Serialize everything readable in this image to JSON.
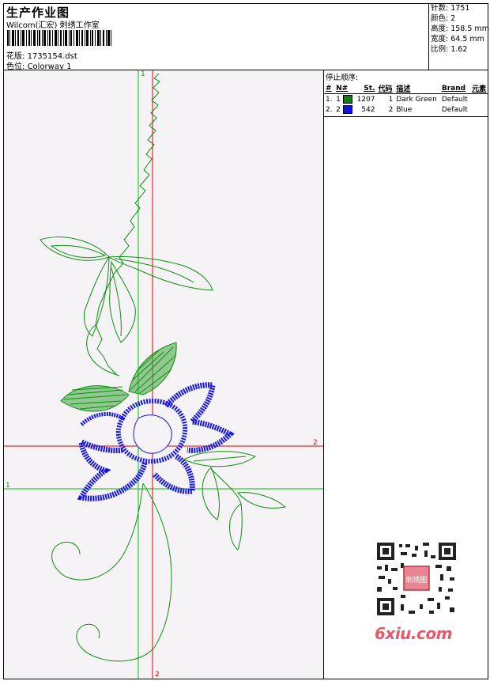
{
  "header": {
    "title": "生产作业图",
    "company": "Wilcom(汇宏) 刺绣工作室",
    "design_label": "花版:",
    "design_file": "1735154.dst",
    "colorway_label": "色位:",
    "colorway_value": "Colorway 1"
  },
  "stats": {
    "stitches": "针数: 1751",
    "colors": "颜色: 2",
    "height": "高度: 158.5 mm",
    "width": "宽度: 64.5 mm",
    "scale": "比例: 1.62"
  },
  "stop_sequence": {
    "title": "停止顺序:",
    "columns": [
      "#",
      "N#",
      "St.",
      "代码",
      "描述",
      "Brand",
      "元素"
    ],
    "rows": [
      {
        "num": "1.",
        "n": "1",
        "color": "#0f7f0f",
        "st": "1207",
        "code": "1",
        "desc": "Dark Green",
        "brand": "Default",
        "element": ""
      },
      {
        "num": "2.",
        "n": "2",
        "color": "#1010e0",
        "st": "542",
        "code": "2",
        "desc": "Blue",
        "brand": "Default",
        "element": ""
      }
    ]
  },
  "axes": {
    "green_top": "1",
    "green_left": "1",
    "red_right": "2",
    "red_bottom": "2"
  },
  "colors": {
    "thread_green": "#0f8f0f",
    "thread_blue": "#1515e6",
    "axis_green": "#00c000",
    "axis_red": "#e00000",
    "logo": "#e55a6a"
  },
  "watermark": {
    "logo_text": "6xiu.com",
    "qr_stamp": "刺绣图"
  }
}
